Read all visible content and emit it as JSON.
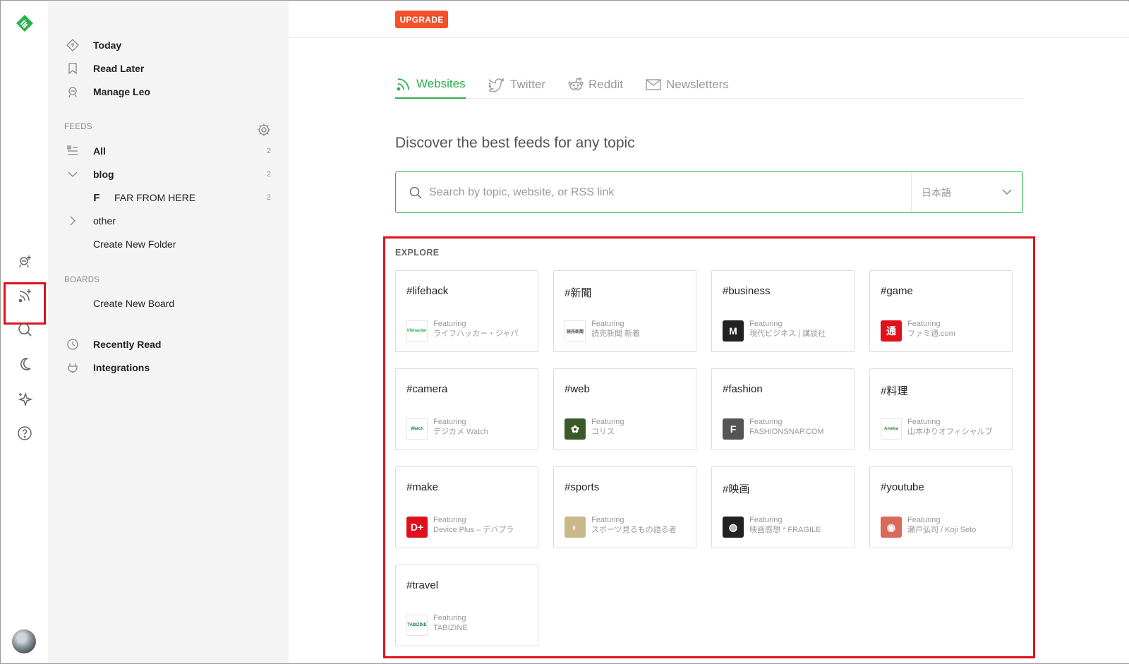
{
  "top": {
    "upgrade_label": "UPGRADE"
  },
  "sidebar": {
    "nav": [
      {
        "label": "Today",
        "icon": "today-icon"
      },
      {
        "label": "Read Later",
        "icon": "bookmark-icon"
      },
      {
        "label": "Manage Leo",
        "icon": "leo-icon"
      }
    ],
    "feeds_title": "FEEDS",
    "feeds": [
      {
        "label": "All",
        "count": "2"
      },
      {
        "label": "blog",
        "count": "2"
      },
      {
        "label": "FAR FROM HERE",
        "count": "2",
        "initial": "F"
      },
      {
        "label": "other"
      },
      {
        "label": "Create New Folder"
      }
    ],
    "boards_title": "BOARDS",
    "boards": [
      {
        "label": "Create New Board"
      }
    ],
    "extra": [
      {
        "label": "Recently Read",
        "icon": "clock-icon"
      },
      {
        "label": "Integrations",
        "icon": "plug-icon"
      }
    ]
  },
  "tabs": [
    {
      "label": "Websites",
      "icon": "rss-icon",
      "active": true
    },
    {
      "label": "Twitter",
      "icon": "twitter-icon"
    },
    {
      "label": "Reddit",
      "icon": "reddit-icon"
    },
    {
      "label": "Newsletters",
      "icon": "mail-icon"
    }
  ],
  "heading": "Discover the best feeds for any topic",
  "search": {
    "placeholder": "Search by topic, website, or RSS link",
    "language": "日本語"
  },
  "explore": {
    "title": "EXPLORE",
    "featuring_label": "Featuring",
    "cards": [
      {
        "tag": "#lifehack",
        "source": "ライフハッカー・ジャパ",
        "thumb": "lifehacker",
        "color": "#2bb24c"
      },
      {
        "tag": "#新聞",
        "source": "読売新聞 新着",
        "thumb": "読売新聞",
        "color": "#555555"
      },
      {
        "tag": "#business",
        "source": "現代ビジネス | 講談社",
        "thumb": "M",
        "color": "#222222"
      },
      {
        "tag": "#game",
        "source": "ファミ通.com",
        "thumb": "通",
        "color": "#e0111c"
      },
      {
        "tag": "#camera",
        "source": "デジカメ Watch",
        "thumb": "Watch",
        "color": "#1d7a6c"
      },
      {
        "tag": "#web",
        "source": "コリス",
        "thumb": "✿",
        "color": "#3b5a2a"
      },
      {
        "tag": "#fashion",
        "source": "FASHIONSNAP.COM",
        "thumb": "F",
        "color": "#555555"
      },
      {
        "tag": "#料理",
        "source": "山本ゆりオフィシャルブ",
        "thumb": "Ameba",
        "color": "#2e8b3a"
      },
      {
        "tag": "#make",
        "source": "Device Plus – デバプラ",
        "thumb": "D+",
        "color": "#e0111c"
      },
      {
        "tag": "#sports",
        "source": "スポーツ見るもの語る者",
        "thumb": "◐",
        "color": "#c9b88a"
      },
      {
        "tag": "#映画",
        "source": "映画感想 * FRAGILE",
        "thumb": "◍",
        "color": "#222222"
      },
      {
        "tag": "#youtube",
        "source": "瀬戸弘司 / Koji Seto",
        "thumb": "◉",
        "color": "#d86a5c"
      },
      {
        "tag": "#travel",
        "source": "TABIZINE",
        "thumb": "TABIZINE",
        "color": "#1d7a6c"
      }
    ]
  },
  "colors": {
    "accent": "#2bb24c",
    "upgrade": "#f3502b",
    "highlight": "#e0111c"
  }
}
